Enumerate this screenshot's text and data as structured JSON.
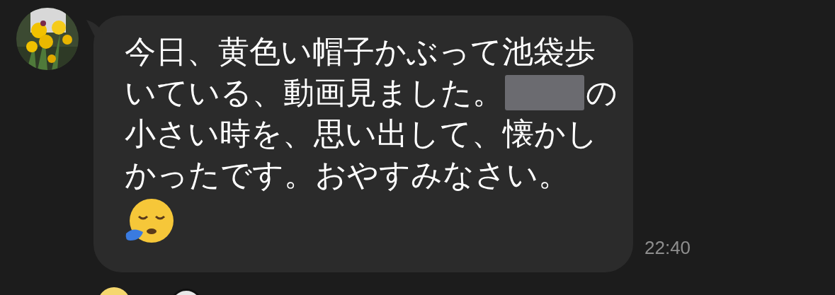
{
  "message": {
    "avatar": {
      "kind": "picture"
    },
    "lines": [
      [
        {
          "kind": "text",
          "text": "今日、黄色い帽子かぶって池袋歩"
        }
      ],
      [
        {
          "kind": "text",
          "text": "いている、動画見ました。"
        },
        {
          "kind": "redacted"
        },
        {
          "kind": "text",
          "text": "の"
        }
      ],
      [
        {
          "kind": "text",
          "text": "小さい時を、思い出して、懐かし"
        }
      ],
      [
        {
          "kind": "text",
          "text": "かったです。おやすみなさい。"
        }
      ]
    ],
    "time": "22:40"
  }
}
